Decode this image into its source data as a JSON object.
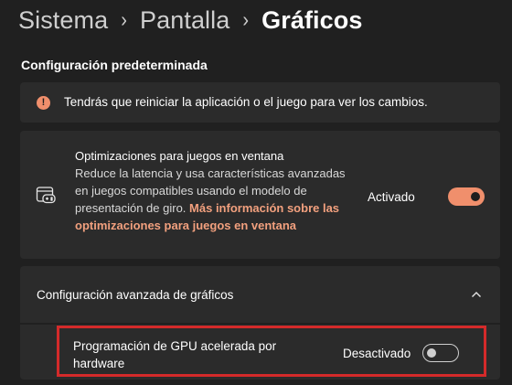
{
  "breadcrumb": {
    "items": [
      "Sistema",
      "Pantalla"
    ],
    "current": "Gráficos",
    "separator": "›"
  },
  "section": {
    "title": "Configuración predeterminada"
  },
  "info_banner": {
    "icon": "exclamation-icon",
    "text": "Tendrás que reiniciar la aplicación o el juego para ver los cambios."
  },
  "windowed_optimizations": {
    "icon": "gamepad-window-icon",
    "title": "Optimizaciones para juegos en ventana",
    "description": "Reduce la latencia y usa características avanzadas en juegos compatibles usando el modelo de presentación de giro.",
    "link": "Más información sobre las optimizaciones para juegos en ventana",
    "state_label": "Activado",
    "enabled": true
  },
  "advanced": {
    "title": "Configuración avanzada de gráficos",
    "expanded": true,
    "gpu_scheduling": {
      "label": "Programación de GPU acelerada por hardware",
      "state_label": "Desactivado",
      "enabled": false
    }
  },
  "colors": {
    "accent": "#f08f6c",
    "highlight_border": "#d42a2a",
    "background": "#202020",
    "card": "#2b2b2b"
  }
}
